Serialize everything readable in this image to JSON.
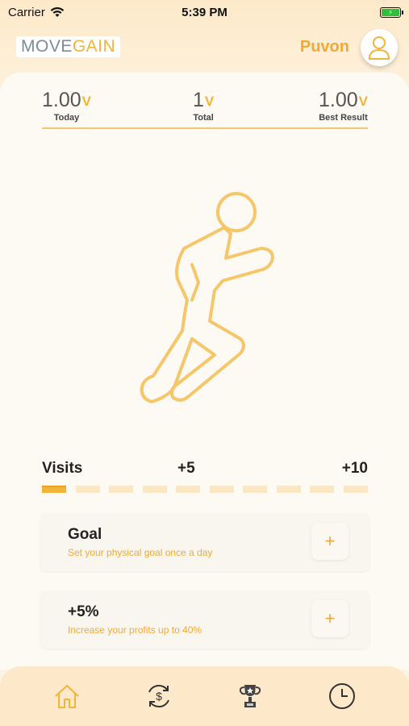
{
  "status_bar": {
    "carrier": "Carrier",
    "time": "5:39 PM"
  },
  "header": {
    "logo_move": "MOVE",
    "logo_gain": "GAIN",
    "username": "Puvon"
  },
  "stats": [
    {
      "value": "1.00",
      "unit": "V",
      "label": "Today"
    },
    {
      "value": "1",
      "unit": "V",
      "label": "Total"
    },
    {
      "value": "1.00",
      "unit": "V",
      "label": "Best Result"
    }
  ],
  "visits": {
    "label": "Visits",
    "mid": "+5",
    "end": "+10",
    "progress_active_segments": 1,
    "segments": 10
  },
  "tasks": [
    {
      "title": "Goal",
      "subtitle": "Set your physical goal once a day",
      "action": "+"
    },
    {
      "title": "+5%",
      "subtitle": "Increase your profits up to 40%",
      "action": "+"
    }
  ],
  "tabbar": {
    "items": [
      {
        "icon": "home-icon",
        "active": true
      },
      {
        "icon": "dollar-exchange-icon",
        "active": false
      },
      {
        "icon": "trophy-icon",
        "active": false
      },
      {
        "icon": "clock-icon",
        "active": false
      }
    ]
  },
  "colors": {
    "accent": "#f3b43a",
    "background": "#fdfaf3",
    "tab_bg": "#fde9c9"
  }
}
